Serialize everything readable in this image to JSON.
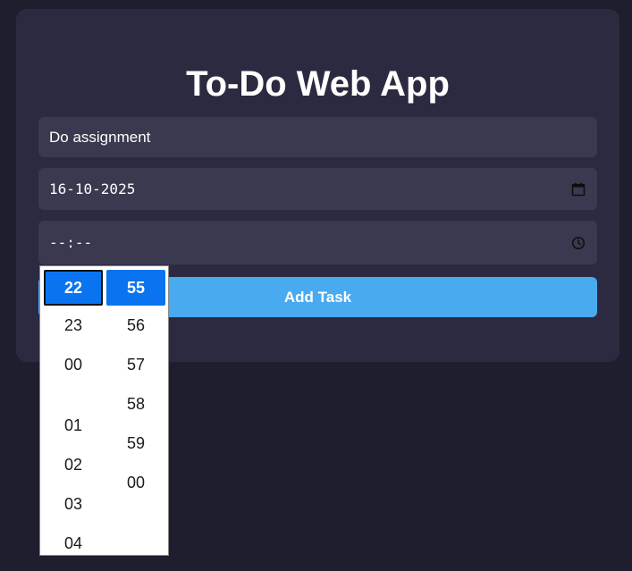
{
  "app": {
    "title": "To-Do Web App"
  },
  "form": {
    "task_value": "Do assignment",
    "date_value": "16-10-2025",
    "time_value": "--:--",
    "add_button_label": "Add Task"
  },
  "time_picker": {
    "hours": [
      "22",
      "23",
      "00",
      "01",
      "02",
      "03",
      "04"
    ],
    "selected_hour": "22",
    "minutes": [
      "55",
      "56",
      "57",
      "58",
      "59",
      "00"
    ],
    "selected_minute": "55"
  },
  "colors": {
    "page_background": "#1f1e2e",
    "card_background": "#2b2a40",
    "field_background": "#3a394f",
    "accent_button": "#4aaaf0",
    "picker_selected": "#0a74f0"
  },
  "icons": {
    "date": "calendar-icon",
    "time": "clock-icon"
  }
}
